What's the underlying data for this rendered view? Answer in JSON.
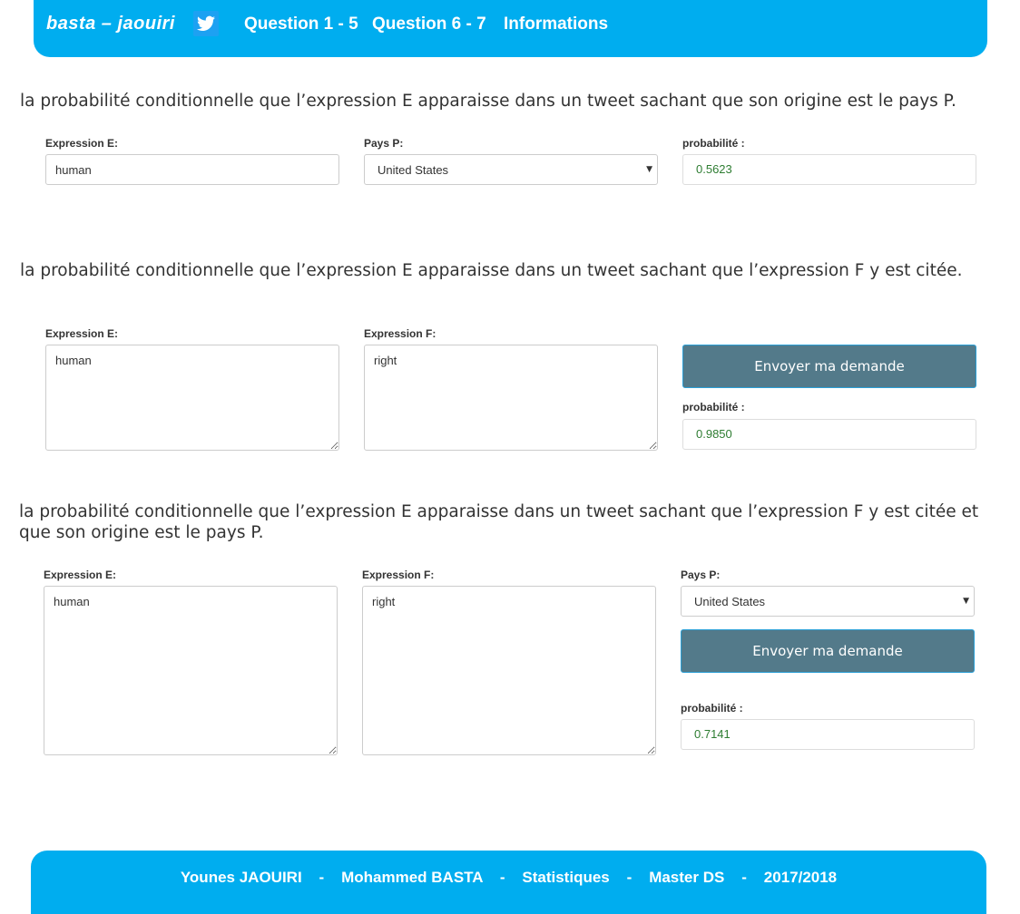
{
  "nav": {
    "brand": "basta – jaouiri",
    "links": [
      "Question 1 - 5",
      "Question 6 - 7",
      "Informations"
    ]
  },
  "section1": {
    "title": "la probabilité conditionnelle que l’expression E apparaisse dans un tweet sachant que son origine est le pays P.",
    "expr_e_label": "Expression E:",
    "expr_e_value": "human",
    "pays_label": "Pays P:",
    "pays_value": "United States",
    "prob_label": "probabilité :",
    "prob_value": "0.5623"
  },
  "section2": {
    "title": "la probabilité conditionnelle que l’expression E apparaisse dans un tweet sachant que l’expression F y est citée.",
    "expr_e_label": "Expression E:",
    "expr_e_value": "human",
    "expr_f_label": "Expression F:",
    "expr_f_value": "right",
    "button_label": "Envoyer ma demande",
    "prob_label": "probabilité :",
    "prob_value": "0.9850"
  },
  "section3": {
    "title": "la probabilité conditionnelle que l’expression E apparaisse dans un tweet sachant que l’expression F y est citée et que son origine est le pays P.",
    "expr_e_label": "Expression E:",
    "expr_e_value": "human",
    "expr_f_label": "Expression F:",
    "expr_f_value": "right",
    "pays_label": "Pays P:",
    "pays_value": "United States",
    "button_label": "Envoyer ma demande",
    "prob_label": "probabilité :",
    "prob_value": "0.7141"
  },
  "footer": {
    "text": "Younes JAOUIRI    -    Mohammed BASTA    -    Statistiques    -    Master DS    -    2017/2018"
  },
  "colors": {
    "accent": "#00adef",
    "button": "#537a8a",
    "result_text": "#2e7d32"
  },
  "icons": {
    "brand_icon": "twitter-icon",
    "select_arrow": "dropdown-arrow-icon"
  }
}
